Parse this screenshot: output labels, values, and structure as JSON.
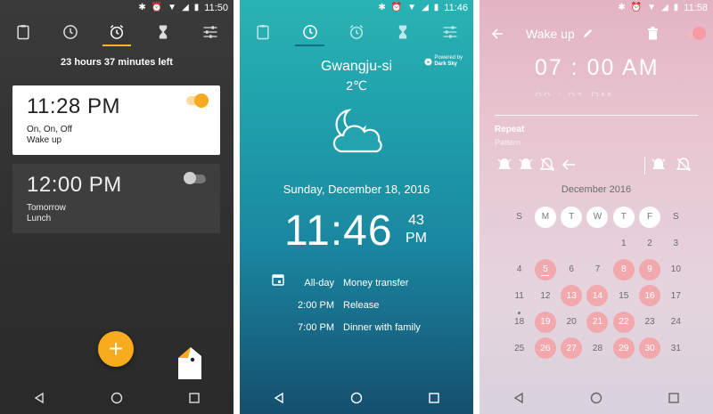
{
  "phone1": {
    "status_time": "11:50",
    "time_left": "23 hours 37 minutes  left",
    "alarms": [
      {
        "time": "11:28 PM",
        "line1": "On, On, Off",
        "line2": "Wake up",
        "enabled": true
      },
      {
        "time": "12:00 PM",
        "line1": "Tomorrow",
        "line2": "Lunch",
        "enabled": false
      }
    ],
    "fab_label": "+"
  },
  "phone2": {
    "status_time": "11:46",
    "city": "Gwangju-si",
    "temperature": "2℃",
    "powered_line1": "Powered by",
    "powered_line2": "Dark Sky",
    "date": "Sunday, December 18, 2016",
    "clock": "11:46",
    "seconds": "43",
    "ampm": "PM",
    "events": [
      {
        "time": "All-day",
        "title": "Money transfer"
      },
      {
        "time": "2:00 PM",
        "title": "Release"
      },
      {
        "time": "7:00 PM",
        "title": "Dinner with family"
      }
    ]
  },
  "phone3": {
    "status_time": "11:58",
    "title": "Wake up",
    "alarm_time": "07 : 00  AM",
    "alarm_time_ghost": "00 : 01  PM",
    "repeat_label": "Repeat",
    "pattern_label": "Pattern",
    "month_label": "December 2016",
    "weekdays": [
      "S",
      "M",
      "T",
      "W",
      "T",
      "F",
      "S"
    ],
    "weeks": [
      [
        "",
        "",
        "",
        "",
        "1",
        "2",
        "3"
      ],
      [
        "4",
        "5",
        "6",
        "7",
        "8",
        "9",
        "10"
      ],
      [
        "11",
        "12",
        "13",
        "14",
        "15",
        "16",
        "17"
      ],
      [
        "18",
        "19",
        "20",
        "21",
        "22",
        "23",
        "24"
      ],
      [
        "25",
        "26",
        "27",
        "28",
        "29",
        "30",
        "31"
      ]
    ],
    "highlighted_days": [
      "5",
      "8",
      "9",
      "13",
      "14",
      "16",
      "19",
      "21",
      "22",
      "26",
      "27",
      "29",
      "30"
    ],
    "active_weekdays": [
      "M",
      "T",
      "W",
      "T",
      "F"
    ]
  },
  "colors": {
    "accent_orange": "#f7ab1d",
    "teal": "#1f9fab",
    "pink_day": "#f1a9ae"
  }
}
